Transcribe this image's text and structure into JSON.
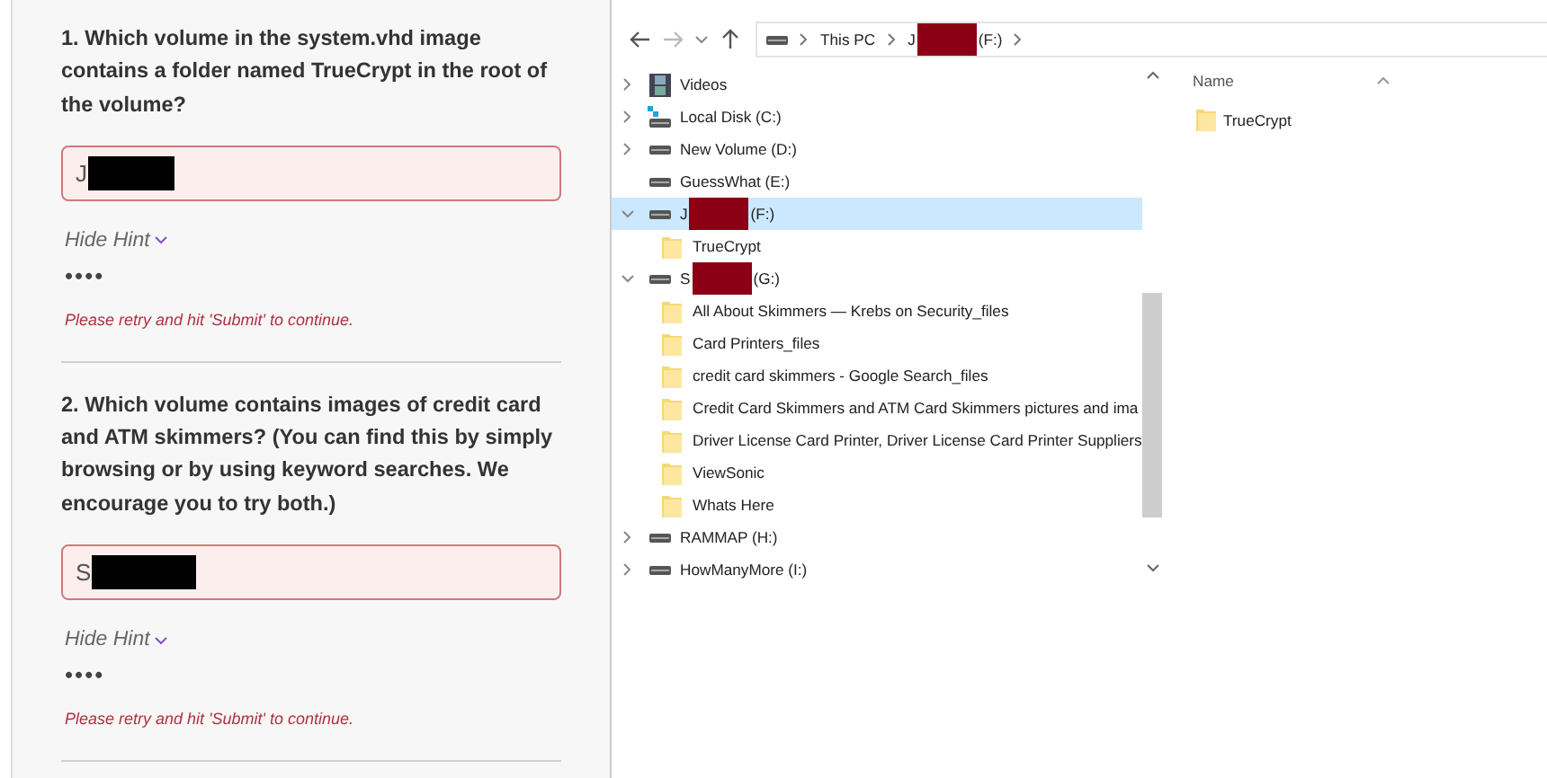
{
  "questions": [
    {
      "prompt": "1. Which volume in the system.vhd image contains a folder named TrueCrypt in the root of the volume?",
      "answer": "J",
      "answer_redacted": true,
      "hint_toggle": "Hide Hint",
      "hint_expanded": true,
      "hint": "••••",
      "error": "Please retry and hit 'Submit' to continue."
    },
    {
      "prompt": "2. Which volume contains images of credit card and ATM skimmers? (You can find this by simply browsing or by using keyword searches. We encourage you to try both.)",
      "answer": "S",
      "answer_redacted": true,
      "hint_toggle": "Hide Hint",
      "hint_expanded": true,
      "hint": "••••",
      "error": "Please retry and hit 'Submit' to continue."
    }
  ],
  "explorer": {
    "breadcrumb": [
      {
        "label": "This PC"
      },
      {
        "label": "J",
        "redacted": true,
        "suffix": "(F:)"
      }
    ],
    "tree": [
      {
        "kind": "videos",
        "label": "Videos",
        "expandable": true,
        "expanded": false,
        "selected": false
      },
      {
        "kind": "local-disk",
        "label": "Local Disk (C:)",
        "expandable": true,
        "expanded": false,
        "selected": false
      },
      {
        "kind": "drive",
        "label": "New Volume (D:)",
        "expandable": true,
        "expanded": false,
        "selected": false
      },
      {
        "kind": "drive",
        "label": "GuessWhat (E:)",
        "expandable": false,
        "selected": false
      },
      {
        "kind": "drive",
        "label": "J",
        "redacted": true,
        "suffix": "(F:)",
        "expandable": true,
        "expanded": true,
        "selected": true,
        "children": [
          {
            "kind": "folder",
            "label": "TrueCrypt",
            "selected": false
          }
        ]
      },
      {
        "kind": "drive",
        "label": "S",
        "redacted": true,
        "suffix": "(G:)",
        "expandable": true,
        "expanded": true,
        "selected": false,
        "children": [
          {
            "kind": "folder",
            "label": "All About Skimmers — Krebs on Security_files",
            "selected": false
          },
          {
            "kind": "folder",
            "label": "Card Printers_files",
            "selected": false
          },
          {
            "kind": "folder",
            "label": "credit card skimmers - Google Search_files",
            "selected": false
          },
          {
            "kind": "folder",
            "label": "Credit Card Skimmers and ATM Card Skimmers pictures and ima",
            "selected": false
          },
          {
            "kind": "folder",
            "label": "Driver License Card Printer, Driver License Card Printer Suppliers",
            "selected": false
          },
          {
            "kind": "folder",
            "label": "ViewSonic",
            "selected": false
          },
          {
            "kind": "folder",
            "label": "Whats Here",
            "selected": false
          }
        ]
      },
      {
        "kind": "drive",
        "label": "RAMMAP (H:)",
        "expandable": true,
        "expanded": false,
        "selected": false
      },
      {
        "kind": "drive",
        "label": "HowManyMore (I:)",
        "expandable": true,
        "expanded": false,
        "selected": false
      }
    ],
    "column": "Name",
    "files": [
      {
        "kind": "folder",
        "label": "TrueCrypt"
      }
    ]
  }
}
